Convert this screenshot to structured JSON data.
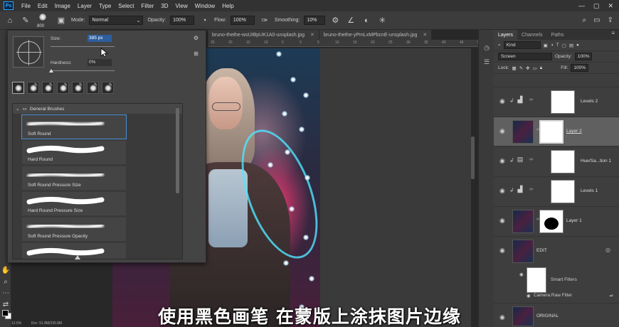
{
  "menubar": {
    "items": [
      "File",
      "Edit",
      "Image",
      "Layer",
      "Type",
      "Select",
      "Filter",
      "3D",
      "View",
      "Window",
      "Help"
    ]
  },
  "options": {
    "brush_size": "800",
    "mode_label": "Mode:",
    "mode_value": "Normal",
    "opacity_label": "Opacity:",
    "opacity_value": "100%",
    "flow_label": "Flow:",
    "flow_value": "100%",
    "smoothing_label": "Smoothing:",
    "smoothing_value": "10%"
  },
  "tabs": [
    {
      "label": "bruno-thethe-wsUIBpUK1A0-unsplash.jpg"
    },
    {
      "label": "bruno-thethe-yPmLxMPbcnE-unsplash.jpg"
    }
  ],
  "ruler": [
    "25",
    "20",
    "15",
    "10",
    "5",
    "0",
    "5",
    "10",
    "15",
    "20",
    "25",
    "30",
    "35",
    "40",
    "45",
    "50"
  ],
  "brush_panel": {
    "size_label": "Size:",
    "size_value": "385 px",
    "hardness_label": "Hardness:",
    "hardness_value": "0%",
    "group_name": "General Brushes",
    "brushes": [
      {
        "name": "Soft Round",
        "selected": true
      },
      {
        "name": "Hard Round",
        "selected": false
      },
      {
        "name": "Soft Round Pressure Size",
        "selected": false
      },
      {
        "name": "Hard Round Pressure Size",
        "selected": false
      },
      {
        "name": "Soft Round Pressure Opacity",
        "selected": false
      },
      {
        "name": "",
        "selected": false
      }
    ]
  },
  "layers_panel": {
    "tabs": [
      "Layers",
      "Channels",
      "Paths"
    ],
    "filter_value": "Kind",
    "blend_mode": "Screen",
    "opacity_label": "Opacity:",
    "opacity_value": "100%",
    "lock_label": "Lock:",
    "fill_label": "Fill:",
    "fill_value": "100%",
    "layers": [
      {
        "name": "Levels 2",
        "type": "adjustment",
        "icon": "levels-icon",
        "selected": false
      },
      {
        "name": "Layer 2",
        "type": "pixel-mask",
        "icon": "",
        "selected": true
      },
      {
        "name": "Hue/Sa...tion 1",
        "type": "adjustment",
        "icon": "hue-saturation-icon",
        "selected": false
      },
      {
        "name": "Levels 1",
        "type": "adjustment",
        "icon": "levels-icon",
        "selected": false
      },
      {
        "name": "Layer 1",
        "type": "pixel-mask",
        "icon": "",
        "selected": false
      },
      {
        "name": "EDIT",
        "type": "smart-object",
        "icon": "",
        "selected": false
      },
      {
        "name": "ORIGINAL",
        "type": "pixel",
        "icon": "",
        "selected": false
      }
    ],
    "smart_filters_label": "Smart Filters",
    "camera_raw_label": "Camera Raw Filter"
  },
  "subtitle": "使用黑色画笔 在蒙版上涂抹图片边缘",
  "status": {
    "zoom": "12.5%",
    "doc": "Doc: 51.8M/235.8M"
  },
  "colors": {
    "foreground": "#000000",
    "background": "#ffffff",
    "accent": "#31a8ff",
    "selection": "#2d5e9e"
  }
}
